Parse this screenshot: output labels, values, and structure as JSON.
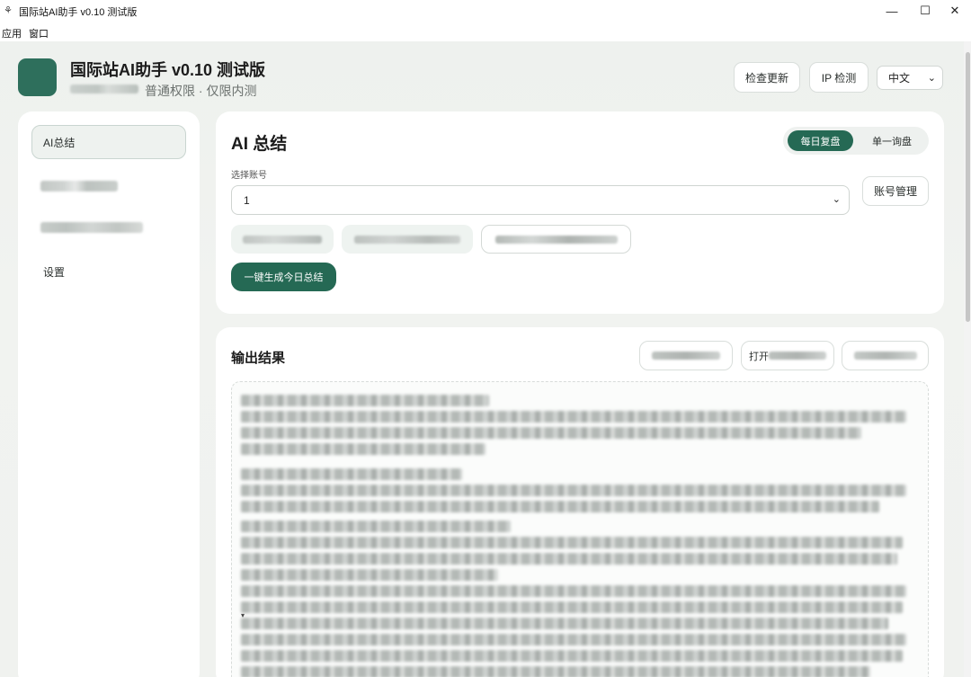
{
  "window": {
    "title": "国际站AI助手 v0.10 测试版",
    "minimize_glyph": "—",
    "maximize_glyph": "☐",
    "close_glyph": "✕"
  },
  "menu": {
    "items": [
      "应用",
      "窗口"
    ]
  },
  "header": {
    "app_title": "国际站AI助手 v0.10 测试版",
    "subtitle": "普通权限 · 仅限内测",
    "check_update_label": "检查更新",
    "ip_check_label": "IP 检测",
    "language_value": "中文"
  },
  "sidebar": {
    "active_item": "AI总结",
    "settings_label": "设置"
  },
  "summary_card": {
    "title": "AI 总结",
    "mode_tabs": [
      "每日复盘",
      "单一询盘"
    ],
    "active_tab": "每日复盘",
    "account_label": "选择账号",
    "account_value": "1",
    "account_manage_label": "账号管理",
    "generate_label": "一键生成今日总结"
  },
  "output_card": {
    "title": "输出结果",
    "open_button_prefix": "打开"
  },
  "colors": {
    "accent": "#256954",
    "logo": "#2e6f5c",
    "background": "#f0f2ef",
    "card": "#ffffff"
  }
}
